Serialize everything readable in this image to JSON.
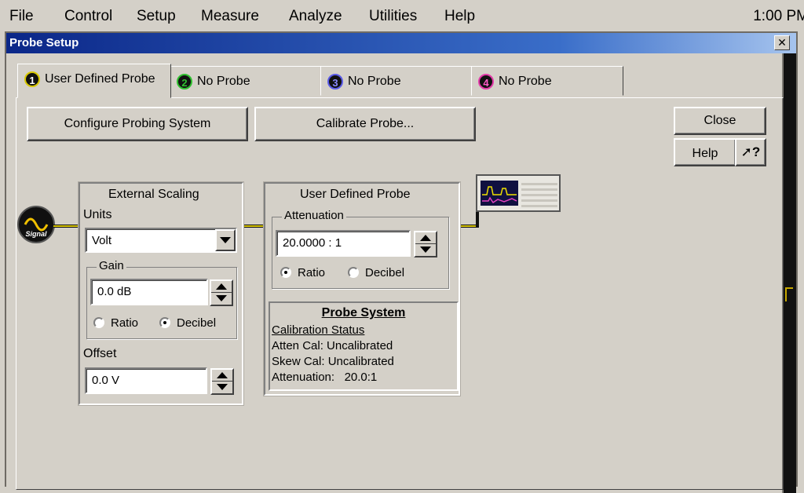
{
  "menubar": {
    "items": [
      "File",
      "Control",
      "Setup",
      "Measure",
      "Analyze",
      "Utilities",
      "Help"
    ],
    "clock": "1:00 PM"
  },
  "dialog": {
    "title": "Probe Setup",
    "close_glyph": "✕"
  },
  "tabs": [
    {
      "number": "1",
      "label": "User Defined Probe",
      "color": "#d8c800",
      "active": true
    },
    {
      "number": "2",
      "label": "No Probe",
      "color": "#2fbf2f",
      "active": false
    },
    {
      "number": "3",
      "label": "No Probe",
      "color": "#5a5ae6",
      "active": false
    },
    {
      "number": "4",
      "label": "No Probe",
      "color": "#e23aa8",
      "active": false
    }
  ],
  "buttons": {
    "configure": "Configure Probing System",
    "calibrate": "Calibrate Probe...",
    "close": "Close",
    "help": "Help",
    "whats_this_glyph": "➚?"
  },
  "signal": {
    "label": "Signal",
    "icon": "sine-wave-icon"
  },
  "external_scaling": {
    "title": "External Scaling",
    "units_label": "Units",
    "units_value": "Volt",
    "gain_label": "Gain",
    "gain_value": "0.0 dB",
    "gain_mode_options": [
      "Ratio",
      "Decibel"
    ],
    "gain_mode_selected": "Decibel",
    "offset_label": "Offset",
    "offset_value": "0.0 V"
  },
  "user_defined_probe": {
    "title": "User Defined Probe",
    "attenuation_label": "Attenuation",
    "attenuation_value": "20.0000 : 1",
    "mode_options": [
      "Ratio",
      "Decibel"
    ],
    "mode_selected": "Ratio"
  },
  "probe_system": {
    "title": "Probe System",
    "calibration_status_label": "Calibration Status",
    "atten_cal": "Atten Cal: Uncalibrated",
    "skew_cal": "Skew Cal: Uncalibrated",
    "attenuation": "Attenuation:   20.0:1"
  },
  "scope": {
    "icon": "oscilloscope-icon"
  }
}
